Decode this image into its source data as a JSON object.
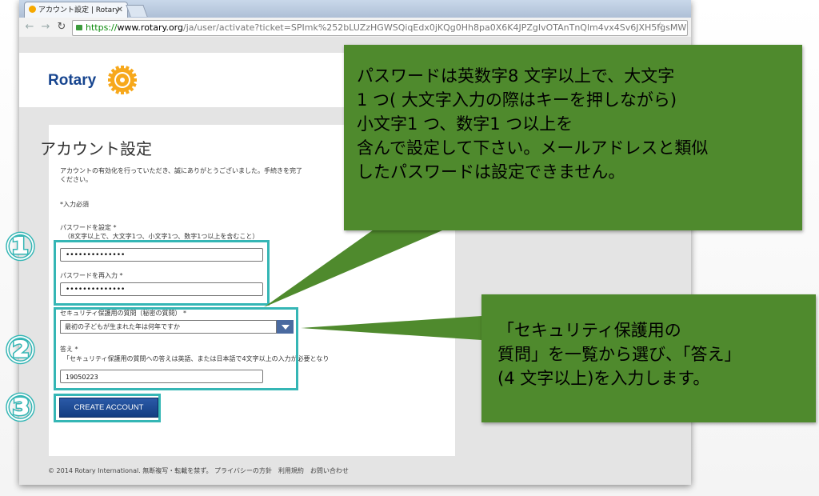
{
  "browser": {
    "tab_title": "アカウント設定 | Rotary",
    "tab_close": "✕",
    "url_scheme": "https://",
    "url_host": "www.rotary.org",
    "url_path": "/ja/user/activate?ticket=SPImk%252bLUZzHGWSQiqEdx0jKQg0Hh8pa0X6K4JPZgIvOTAnTnQlm4vx4Sv6JXH5fgsMW"
  },
  "site": {
    "logo_text": "Rotary"
  },
  "form": {
    "title": "アカウント設定",
    "intro_line1": "アカウントの有効化を行っていただき、誠にありがとうございました。手続きを完了",
    "intro_line2": "ください。",
    "required_note": "*入力必須",
    "password_label": "パスワードを設定 *",
    "password_hint": "（8文字以上で、大文字1つ、小文字1つ、数字1つ以上を含むこと）",
    "password_value": "••••••••••••••",
    "password_confirm_label": "パスワードを再入力 *",
    "password_confirm_value": "••••••••••••••",
    "security_question_label": "セキュリティ保護用の質問（秘密の質問） *",
    "security_question_selected": "最初の子どもが生まれた年は何年ですか",
    "answer_label": "答え *",
    "answer_hint": "「セキュリティ保護用の質問への答えは英語、または日本語で4文字以上の入力が必要となり",
    "answer_value": "19050223",
    "create_button": "CREATE ACCOUNT"
  },
  "footer": {
    "text": "© 2014 Rotary International. 無断複写・転載を禁ず。 プライバシーの方針　利用規約　お問い合わせ"
  },
  "annotations": {
    "step1": "①",
    "step2": "②",
    "step3": "③",
    "callout1_lines": [
      "パスワードは英数字8 文字以上で、大文字",
      "1 つ( 大文字入力の際はキーを押しながら)",
      "小文字1 つ、数字1 つ以上を",
      "含んで設定して下さい。メールアドレスと類似",
      "したパスワードは設定できません。"
    ],
    "callout2_lines": [
      "「セキュリティ保護用の",
      "質問」を一覧から選び、「答え」",
      "(4 文字以上)を入力します。"
    ]
  },
  "colors": {
    "highlight": "#35b6b5",
    "callout": "#4f8a2d",
    "rotary_blue": "#17458f",
    "rotary_gold": "#f7a81b"
  }
}
